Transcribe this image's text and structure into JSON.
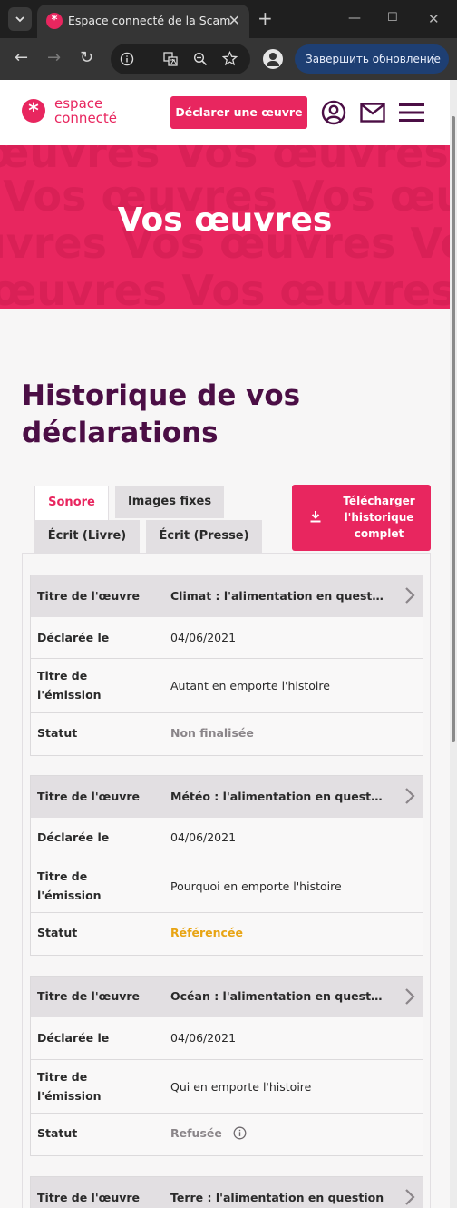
{
  "browser": {
    "tab_title": "Espace connecté de la Scam",
    "update_label": "Завершить обновление"
  },
  "header": {
    "logo_line1": "espace",
    "logo_line2": "connecté",
    "declare_label": "Déclarer une œuvre"
  },
  "hero": {
    "title": "Vos œuvres",
    "bg_lines": [
      "œuvres Vos œuvres Vos œuvres",
      "s Vos œuvres Vos œuvres Vos",
      "uvres Vos œuvres Vos œuvres",
      "œuvres Vos œuvres Vos œuv"
    ]
  },
  "section": {
    "title": "Historique de vos déclarations"
  },
  "tabs": [
    {
      "label": "Sonore",
      "active": true
    },
    {
      "label": "Images fixes",
      "active": false
    },
    {
      "label": "Écrit (Livre)",
      "active": false
    },
    {
      "label": "Écrit (Presse)",
      "active": false
    }
  ],
  "download_label": "Télécharger l'historique complet",
  "labels": {
    "work_title": "Titre de l'œuvre",
    "declared_on": "Déclarée le",
    "broadcast_title": "Titre de l'émission",
    "status": "Statut"
  },
  "declarations": [
    {
      "work_title": "Climat : l'alimentation en question",
      "declared_on": "04/06/2021",
      "broadcast_title": "Autant en emporte l'histoire",
      "status": "Non finalisée"
    },
    {
      "work_title": "Météo : l'alimentation en question",
      "declared_on": "04/06/2021",
      "broadcast_title": "Pourquoi en emporte l'histoire",
      "status": "Référencée"
    },
    {
      "work_title": "Océan : l'alimentation en question",
      "declared_on": "04/06/2021",
      "broadcast_title": "Qui en emporte l'histoire",
      "status": "Refusée"
    },
    {
      "work_title": "Terre : l'alimentation en question"
    }
  ]
}
